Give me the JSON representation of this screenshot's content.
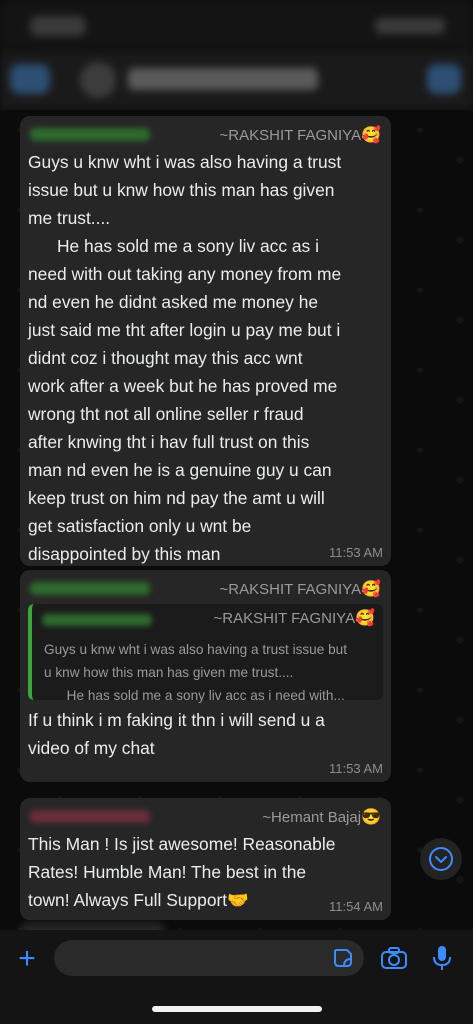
{
  "colors": {
    "background": "#0b0b0b",
    "bubble": "#262626",
    "accent_blue": "#3b8cff",
    "quote_bar": "#3ba83b",
    "sender_phone_green": "#2e6a2e"
  },
  "messages": [
    {
      "sender_name": "~RAKSHIT FAGNIYA",
      "sender_emoji": "🥰",
      "text": "Guys u knw wht i was also having a trust\nissue but u knw how this man has given\nme trust....\n      He has sold me a sony liv acc as i\nneed with out taking any money from me\nnd even he didnt asked me money he\njust said me tht after login u pay me but i\ndidnt coz i thought may this acc wnt\nwork after a week but he has proved me\nwrong tht not all online seller r fraud\nafter knwing tht i hav full trust on this\nman nd even he is a genuine guy u can\nkeep trust on him nd pay the amt u will\nget satisfaction only u wnt be\ndisappointed by this man",
      "time": "11:53 AM"
    },
    {
      "sender_name": "~RAKSHIT FAGNIYA",
      "sender_emoji": "🥰",
      "quote": {
        "sender_name": "~RAKSHIT FAGNIYA",
        "sender_emoji": "🥰",
        "text": "Guys u knw wht i was also having a trust issue but\nu knw how this man has given me trust....\n      He has sold me a sony liv acc as i need with..."
      },
      "text": "If u think i m faking it thn i will send u a\nvideo of my chat",
      "time": "11:53 AM"
    },
    {
      "sender_name": "~Hemant Bajaj",
      "sender_emoji": "😎",
      "text": "This Man ! Is jist awesome! Reasonable\nRates! Humble Man! The best in the\ntown! Always Full Support🤝",
      "time": "11:54 AM"
    }
  ],
  "icons": {
    "back": "back-icon",
    "call": "call-icon",
    "scroll_down": "chevron-down-icon",
    "attach": "plus-icon",
    "sticker": "sticker-icon",
    "camera": "camera-icon",
    "mic": "mic-icon"
  },
  "input": {
    "plus_glyph": "+"
  }
}
